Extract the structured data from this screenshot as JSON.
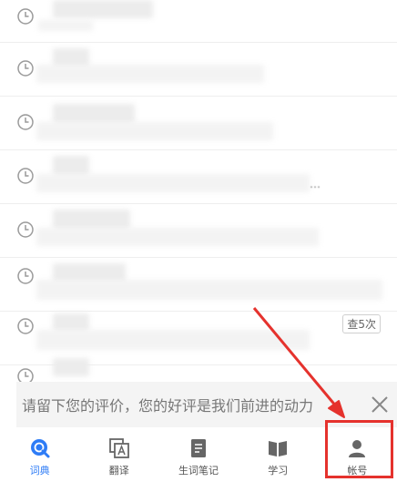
{
  "history": {
    "rows": [
      {
        "tail": ""
      },
      {
        "tail": ""
      },
      {
        "tail": ""
      },
      {
        "tail": "…"
      },
      {
        "tail": ""
      },
      {
        "tail": ""
      },
      {
        "tail": ""
      },
      {
        "tail": ""
      }
    ],
    "badge": "查5次"
  },
  "feedback": {
    "text": "请留下您的评价，您的好评是我们前进的动力"
  },
  "tabbar": {
    "items": [
      {
        "label": "词典",
        "icon": "search-icon"
      },
      {
        "label": "翻译",
        "icon": "translate-icon"
      },
      {
        "label": "生词笔记",
        "icon": "notebook-icon"
      },
      {
        "label": "学习",
        "icon": "book-icon"
      },
      {
        "label": "帐号",
        "icon": "user-icon"
      }
    ],
    "active": 0
  },
  "colors": {
    "accent": "#2e7cf6",
    "annotation": "#e5322d"
  }
}
